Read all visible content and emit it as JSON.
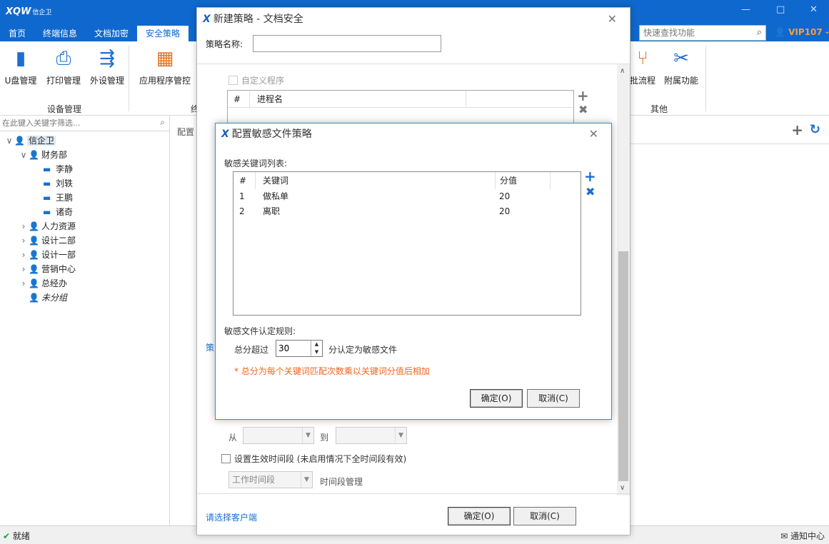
{
  "app": {
    "logo": "XQW",
    "logo_sub": "信企卫",
    "tabs": [
      "首页",
      "终端信息",
      "文档加密",
      "安全策略"
    ],
    "search_placeholder": "快速查找功能",
    "vip": "VIP107 -",
    "win_min": "—",
    "win_max": "□",
    "win_close": "✕"
  },
  "ribbon": {
    "buttons": [
      {
        "label": "U盘管理",
        "icon": "usb-drive-icon"
      },
      {
        "label": "打印管理",
        "icon": "printer-icon"
      },
      {
        "label": "外设管理",
        "icon": "usb-device-icon"
      },
      {
        "label": "应用程序管控",
        "icon": "app-grid-icon"
      }
    ],
    "group_device": "设备管理",
    "group_partial": "终",
    "right_buttons": [
      {
        "label": "批流程",
        "icon": "workflow-icon"
      },
      {
        "label": "附属功能",
        "icon": "tools-icon"
      }
    ],
    "group_other": "其他"
  },
  "left_panel": {
    "filter_placeholder": "在此键入关键字筛选...",
    "tree": [
      {
        "label": "信企卫",
        "level": 0,
        "arrow": "∨",
        "kind": "group",
        "selected": true
      },
      {
        "label": "财务部",
        "level": 1,
        "arrow": "∨",
        "kind": "group"
      },
      {
        "label": "李静",
        "level": 2,
        "arrow": "",
        "kind": "pc"
      },
      {
        "label": "刘轶",
        "level": 2,
        "arrow": "",
        "kind": "pc"
      },
      {
        "label": "王鹏",
        "level": 2,
        "arrow": "",
        "kind": "pc"
      },
      {
        "label": "诸奇",
        "level": 2,
        "arrow": "",
        "kind": "pc"
      },
      {
        "label": "人力资源",
        "level": 1,
        "arrow": "›",
        "kind": "group"
      },
      {
        "label": "设计二部",
        "level": 1,
        "arrow": "›",
        "kind": "group"
      },
      {
        "label": "设计一部",
        "level": 1,
        "arrow": "›",
        "kind": "group"
      },
      {
        "label": "营销中心",
        "level": 1,
        "arrow": "›",
        "kind": "group"
      },
      {
        "label": "总经办",
        "level": 1,
        "arrow": "›",
        "kind": "group"
      },
      {
        "label": "未分组",
        "level": 1,
        "arrow": "",
        "kind": "group",
        "italic": true
      }
    ]
  },
  "mid_strip_label": "配置",
  "status": {
    "ready": "就绪",
    "notify": "通知中心"
  },
  "dialog_policy": {
    "title": "新建策略 - 文档安全",
    "name_label": "策略名称:",
    "name_value": "",
    "custom_program_label": "自定义程序",
    "proc_col_num": "#",
    "proc_col_name": "进程名",
    "partial_label": "策",
    "from_label": "从",
    "to_label": "到",
    "time_period_label": "设置生效时间段 (未启用情况下全时间段有效)",
    "time_period_value": "工作时间段",
    "time_mgmt_label": "时间段管理",
    "select_client_link": "请选择客户端",
    "ok": "确定(O)",
    "cancel": "取消(C)"
  },
  "dialog_sensitive": {
    "title": "配置敏感文件策略",
    "keywords_label": "敏感关键词列表:",
    "columns": [
      "#",
      "关键词",
      "分值"
    ],
    "rows": [
      {
        "num": "1",
        "keyword": "做私单",
        "score": "20"
      },
      {
        "num": "2",
        "keyword": "离职",
        "score": "20"
      }
    ],
    "rule_label": "敏感文件认定规则:",
    "total_prefix": "总分超过",
    "threshold": "30",
    "total_suffix": "分认定为敏感文件",
    "note": "* 总分为每个关键词匹配次数乘以关键词分值后相加",
    "ok": "确定(O)",
    "cancel": "取消(C)"
  }
}
